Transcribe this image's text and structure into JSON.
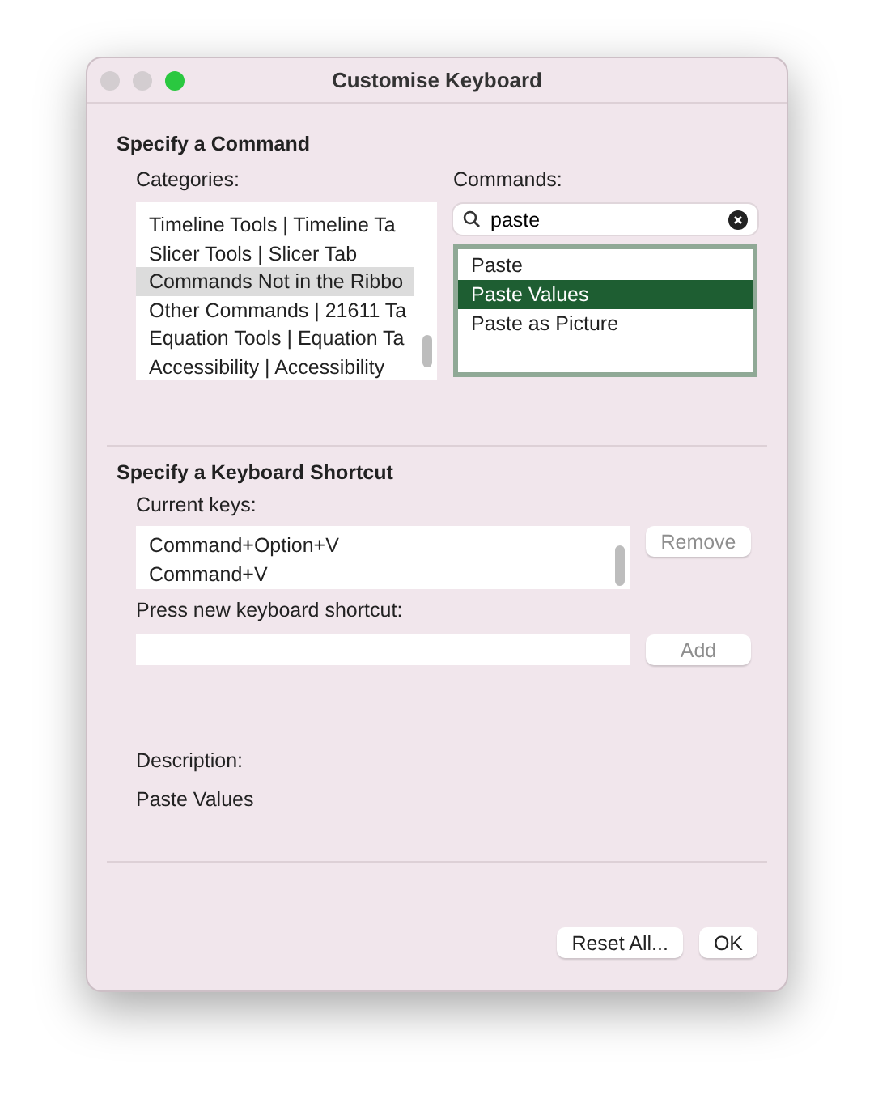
{
  "window": {
    "title": "Customise Keyboard"
  },
  "command_section": {
    "heading": "Specify a Command",
    "categories": {
      "label": "Categories:",
      "items": [
        {
          "label": "Timeline Tools | Timeline Ta",
          "selected": false
        },
        {
          "label": "Slicer Tools | Slicer Tab",
          "selected": false
        },
        {
          "label": "Commands Not in the Ribbo",
          "selected": true
        },
        {
          "label": "Other Commands | 21611 Ta",
          "selected": false
        },
        {
          "label": "Equation Tools | Equation Ta",
          "selected": false
        },
        {
          "label": "Accessibility | Accessibility",
          "selected": false
        }
      ]
    },
    "commands": {
      "label": "Commands:",
      "search": {
        "value": "paste"
      },
      "items": [
        {
          "label": "Paste",
          "selected": false
        },
        {
          "label": "Paste Values",
          "selected": true
        },
        {
          "label": "Paste as Picture",
          "selected": false
        }
      ]
    }
  },
  "shortcut_section": {
    "heading": "Specify a Keyboard Shortcut",
    "current_keys_label": "Current keys:",
    "current_keys": [
      "Command+Option+V",
      "Command+V"
    ],
    "remove_button": {
      "label": "Remove",
      "disabled": true
    },
    "new_shortcut_label": "Press new keyboard shortcut:",
    "add_button": {
      "label": "Add",
      "disabled": true
    }
  },
  "description": {
    "label": "Description:",
    "text": "Paste Values"
  },
  "buttons": [
    {
      "label": "Reset All..."
    },
    {
      "label": "OK"
    }
  ]
}
